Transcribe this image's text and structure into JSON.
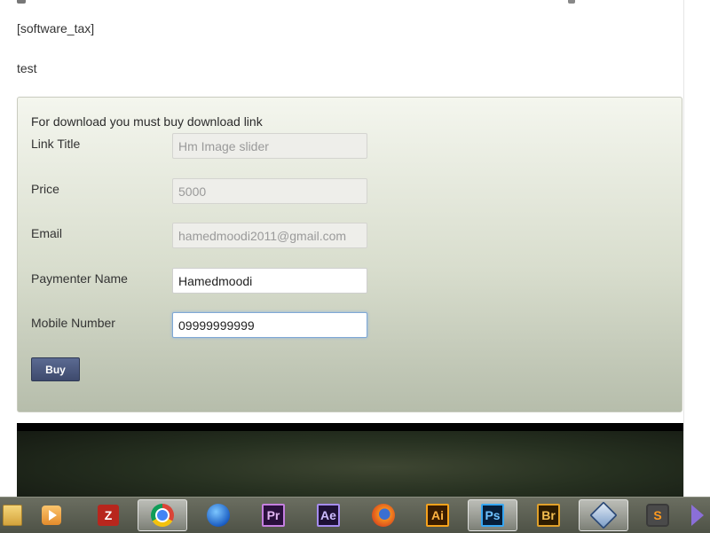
{
  "content": {
    "shortcode": "[software_tax]",
    "test_text": "test"
  },
  "form": {
    "intro": "For download you must buy download link",
    "fields": [
      {
        "label": "Link Title",
        "value": "Hm Image slider",
        "state": "disabled"
      },
      {
        "label": "Price",
        "value": "5000",
        "state": "disabled"
      },
      {
        "label": "Email",
        "value": "hamedmoodi2011@gmail.com",
        "state": "disabled"
      },
      {
        "label": "Paymenter Name",
        "value": "Hamedmoodi",
        "state": "editable"
      },
      {
        "label": "Mobile Number",
        "value": "09999999999",
        "state": "focused"
      }
    ],
    "buy_label": "Buy"
  },
  "taskbar": {
    "items": [
      {
        "name": "explorer-icon",
        "active": false
      },
      {
        "name": "media-player-icon",
        "active": false
      },
      {
        "name": "filezilla-icon",
        "active": false
      },
      {
        "name": "chrome-icon",
        "active": true
      },
      {
        "name": "browser-globe-icon",
        "active": false
      },
      {
        "name": "premiere-icon",
        "text": "Pr",
        "active": false
      },
      {
        "name": "after-effects-icon",
        "text": "Ae",
        "active": false
      },
      {
        "name": "firefox-icon",
        "active": false
      },
      {
        "name": "illustrator-icon",
        "text": "Ai",
        "active": false
      },
      {
        "name": "photoshop-icon",
        "text": "Ps",
        "active": true
      },
      {
        "name": "bridge-icon",
        "text": "Br",
        "active": false
      },
      {
        "name": "virtualbox-icon",
        "active": true
      },
      {
        "name": "sublime-text-icon",
        "text": "S",
        "active": false
      },
      {
        "name": "show-more-icon",
        "active": false
      }
    ]
  }
}
